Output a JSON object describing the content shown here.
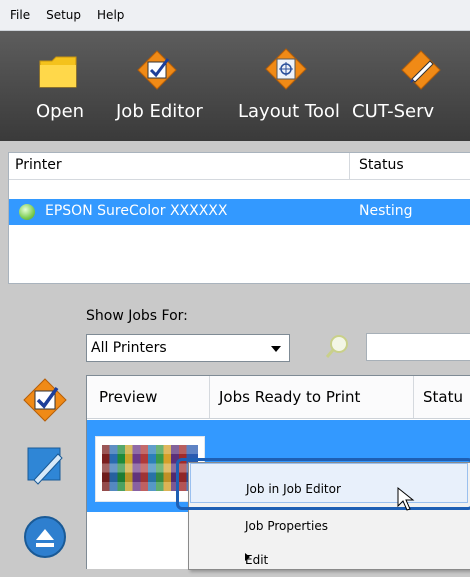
{
  "menu": {
    "file": "File",
    "setup": "Setup",
    "help": "Help"
  },
  "toolbar": {
    "open": "Open",
    "job_editor": "Job Editor",
    "layout_tool": "Layout Tool",
    "cut_server": "CUT-Serv"
  },
  "printers": {
    "col_printer": "Printer",
    "col_status": "Status",
    "rows": [
      {
        "name": "EPSON SureColor XXXXXX",
        "status": "Nesting"
      }
    ]
  },
  "filter": {
    "label": "Show Jobs For:",
    "selected": "All Printers"
  },
  "jobs": {
    "col_preview": "Preview",
    "col_ready": "Jobs Ready to Print",
    "col_status": "Statu"
  },
  "context_menu": {
    "items": [
      "Job in Job Editor",
      "Job Properties",
      "Edit"
    ]
  },
  "colors": {
    "selection": "#3399ff",
    "toolbar": "#4a4a4a",
    "highlight": "#1e5fb4"
  }
}
